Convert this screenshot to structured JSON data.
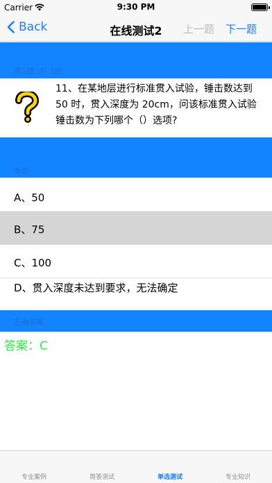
{
  "status": {
    "carrier": "Carrier",
    "time": "9:30 PM"
  },
  "nav": {
    "back_label": "Back",
    "title": "在线测试2",
    "prev_label": "上一题",
    "next_label": "下一题"
  },
  "sections": {
    "question_header": "第1题 (共 3题",
    "options_header": "单选",
    "answer_header": "正确答案"
  },
  "question": {
    "icon": "question-mark-icon",
    "text": "11、在某地层进行标准贯入试验，锤击数达到 50 时，贯入深度为 20cm，问该标准贯入试验锤击数为下列哪个（）选项?"
  },
  "options": [
    {
      "label": "A、50",
      "selected": false
    },
    {
      "label": "B、75",
      "selected": true
    },
    {
      "label": "C、100",
      "selected": false
    },
    {
      "label": "D、贯入深度未达到要求，无法确定",
      "selected": false
    }
  ],
  "answer": {
    "text": "答案：C",
    "color": "#2ee84a"
  },
  "tabs": [
    {
      "label": "专业案例",
      "active": false
    },
    {
      "label": "简答测试",
      "active": false
    },
    {
      "label": "单选测试",
      "active": true
    },
    {
      "label": "专业知识",
      "active": false
    }
  ],
  "colors": {
    "accent": "#1a7cff",
    "section_bar": "#1384ff",
    "selected_row": "#d5d5d5"
  }
}
